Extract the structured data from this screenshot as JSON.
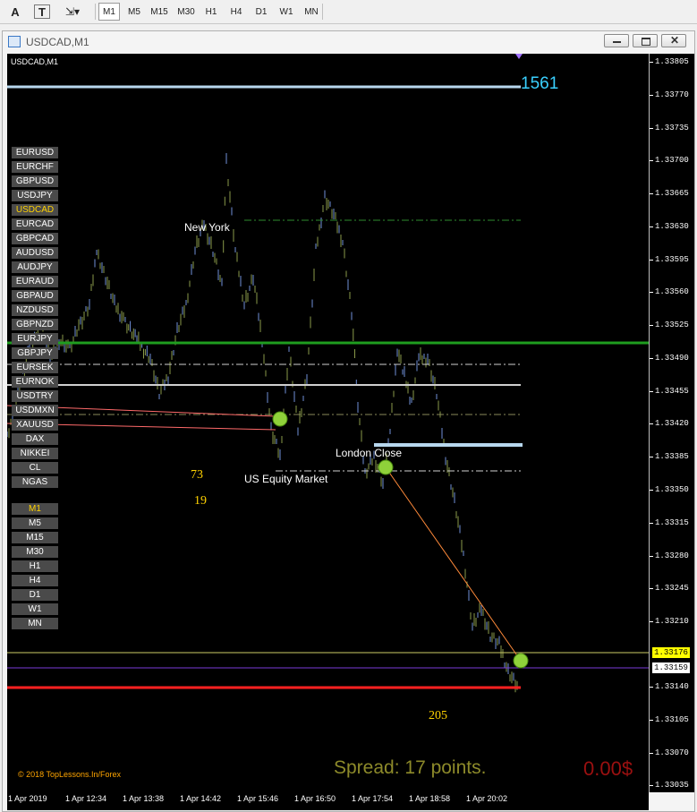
{
  "toolbar": {
    "tools": [
      {
        "icon": "cursor-icon",
        "glyph": "A"
      },
      {
        "icon": "text-tool-icon",
        "glyph": "T"
      },
      {
        "icon": "arrows-tool-icon",
        "glyph": "⇲▾"
      }
    ],
    "timeframes": [
      "M1",
      "M5",
      "M15",
      "M30",
      "H1",
      "H4",
      "D1",
      "W1",
      "MN"
    ],
    "active_timeframe": "M1"
  },
  "window": {
    "title": "USDCAD,M1",
    "buttons": [
      "minimize-button",
      "restore-button",
      "close-button"
    ]
  },
  "chart": {
    "symbol_label": "USDCAD,M1",
    "symbols": [
      "EURUSD",
      "EURCHF",
      "GBPUSD",
      "USDJPY",
      "USDCAD",
      "EURCAD",
      "GBPCAD",
      "AUDUSD",
      "AUDJPY",
      "EURAUD",
      "GBPAUD",
      "NZDUSD",
      "GBPNZD",
      "EURJPY",
      "GBPJPY",
      "EURSEK",
      "EURNOK",
      "USDTRY",
      "USDMXN",
      "XAUUSD",
      "DAX",
      "NIKKEI",
      "CL",
      "NGAS"
    ],
    "selected_symbol": "USDCAD",
    "timeframes": [
      "M1",
      "M5",
      "M15",
      "M30",
      "H1",
      "H4",
      "D1",
      "W1",
      "MN"
    ],
    "selected_timeframe": "M1",
    "annotations": {
      "counter_top": "1561",
      "new_york": "New York",
      "london_close": "London Close",
      "us_equity": "US Equity Market",
      "num_73": "73",
      "num_19": "19",
      "num_205": "205",
      "copyright": "© 2018 TopLessons.In/Forex",
      "spread": "Spread: 17 points.",
      "profit": "0.00$"
    },
    "price_axis": [
      "1.33805",
      "1.33770",
      "1.33735",
      "1.33700",
      "1.33665",
      "1.33630",
      "1.33595",
      "1.33560",
      "1.33525",
      "1.33490",
      "1.33455",
      "1.33420",
      "1.33385",
      "1.33350",
      "1.33315",
      "1.33280",
      "1.33245",
      "1.33210",
      "1.33140",
      "1.33105",
      "1.33070",
      "1.33035"
    ],
    "bid_badge": "1.33176",
    "ask_badge": "1.33159",
    "time_axis": [
      "1 Apr 2019",
      "1 Apr 12:34",
      "1 Apr 13:38",
      "1 Apr 14:42",
      "1 Apr 15:46",
      "1 Apr 16:50",
      "1 Apr 17:54",
      "1 Apr 18:58",
      "1 Apr 20:02"
    ],
    "colors": {
      "background": "#000000",
      "candle": "#8a9a4a",
      "candle_alt": "#6f8fd8",
      "green_level": "#1f9d1f",
      "red_level": "#ff2020",
      "light_blue_level": "#b7d7ee",
      "counter": "#39d0ff",
      "spread": "#8d8a2a",
      "profit": "#9b1010"
    }
  }
}
